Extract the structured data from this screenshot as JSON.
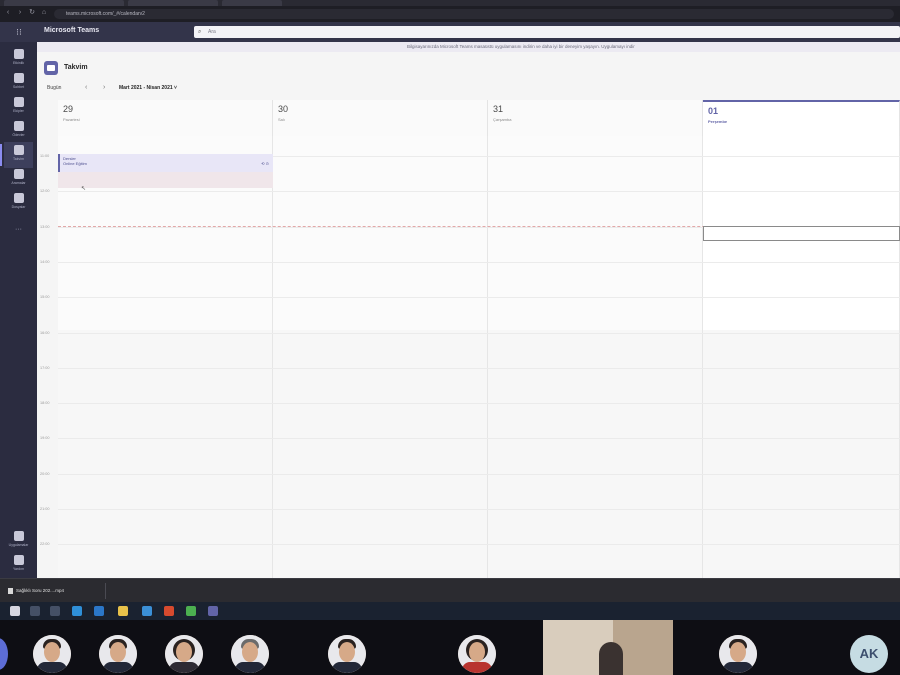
{
  "browser": {
    "url": "teams.microsoft.com/_#/calendarv2"
  },
  "teams": {
    "app_name": "Microsoft Teams",
    "search_placeholder": "Ara",
    "rail": [
      {
        "label": "Etkinlik",
        "icon": "bell-icon"
      },
      {
        "label": "Sohbet",
        "icon": "chat-icon"
      },
      {
        "label": "Ekipler",
        "icon": "teams-icon"
      },
      {
        "label": "Ödevler",
        "icon": "assignments-icon"
      },
      {
        "label": "Takvim",
        "icon": "calendar-icon"
      },
      {
        "label": "Aramalar",
        "icon": "phone-icon"
      },
      {
        "label": "Dosyalar",
        "icon": "files-icon"
      },
      {
        "label": "Uygulamalar",
        "icon": "apps-icon"
      },
      {
        "label": "Yardım",
        "icon": "help-icon"
      }
    ],
    "accent_color": "#6264a7"
  },
  "calendar": {
    "banner": "Bilgisayarınızda Microsoft Teams masaüstü uygulamasını indirin ve daha iyi bir deneyim yaşayın. Uygulamayı indir",
    "title": "Takvim",
    "today_label": "Bugün",
    "range_label": "Mart 2021 - Nisan 2021",
    "days": [
      {
        "num": "29",
        "name": "Pazartesi"
      },
      {
        "num": "30",
        "name": "Salı"
      },
      {
        "num": "31",
        "name": "Çarşamba"
      },
      {
        "num": "01",
        "name": "Perşembe"
      }
    ],
    "time_labels": [
      "11:00",
      "12:00",
      "13:00",
      "14:00",
      "15:00",
      "16:00",
      "17:00",
      "18:00",
      "19:00",
      "20:00",
      "21:00",
      "22:00",
      "23:00"
    ],
    "event": {
      "title": "Dersler",
      "organizer": "Online Eğitim",
      "icons": "⟲ ⊙"
    }
  },
  "download": {
    "file_name": "Sağlıklı Soru 202....mp4"
  },
  "video": {
    "initials": "AK"
  }
}
